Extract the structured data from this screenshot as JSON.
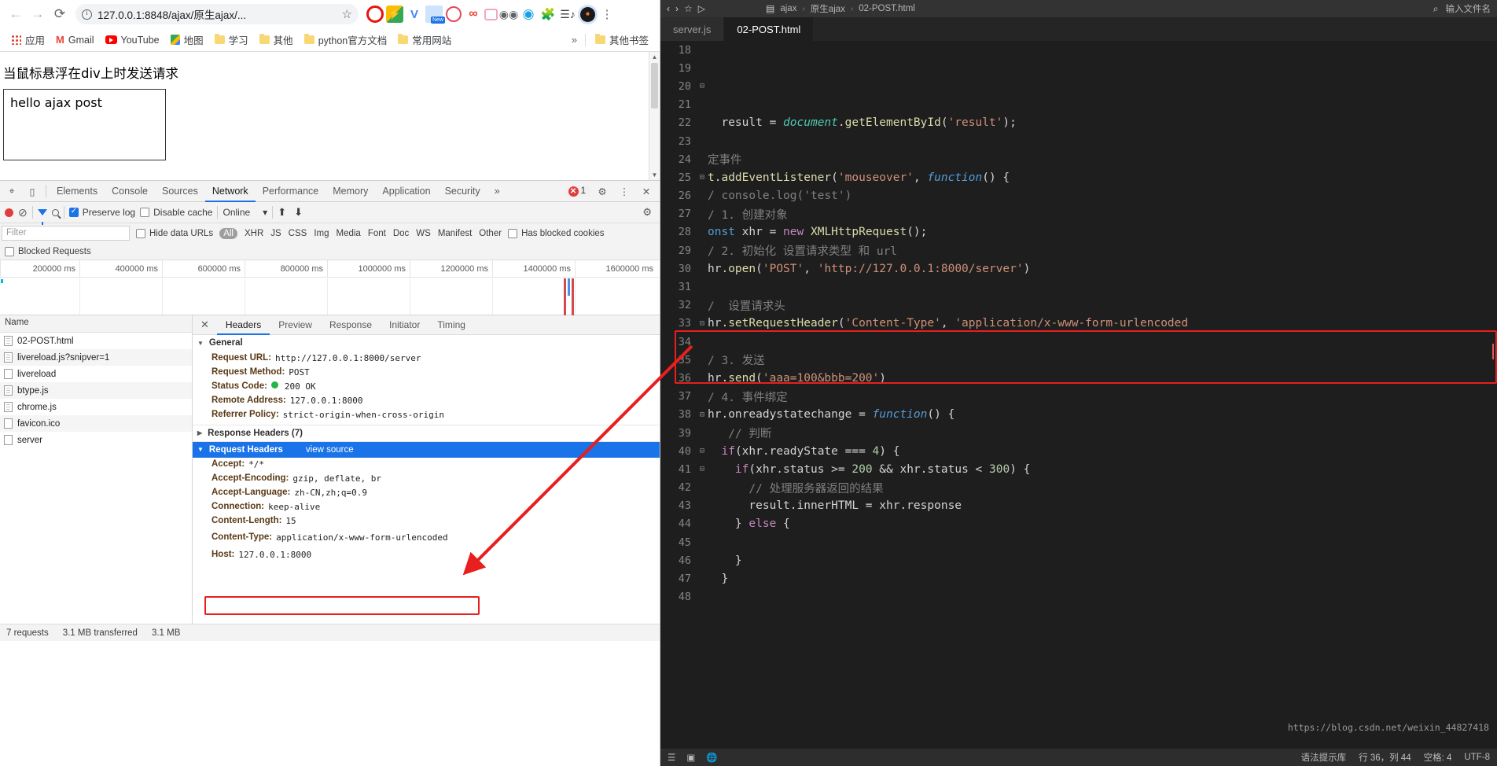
{
  "browser": {
    "nav": {
      "back": "←",
      "forward": "→",
      "reload": "⟳"
    },
    "address": {
      "url": "127.0.0.1:8848/ajax/原生ajax/...",
      "security_icon": "info-icon",
      "star_icon": "star-icon"
    },
    "extensions": [
      "opera-icon",
      "lightning-icon",
      "v-icon",
      "new-badge-icon",
      "play-icon",
      "infinity-icon",
      "tv-icon",
      "goggles-icon",
      "blue-circle-icon",
      "puzzle-icon",
      "playlist-icon",
      "profile-avatar",
      "menu-dots-icon"
    ],
    "bookmarks": [
      {
        "label": "应用",
        "icon": "apps-grid-icon"
      },
      {
        "label": "Gmail",
        "icon": "gmail-icon"
      },
      {
        "label": "YouTube",
        "icon": "youtube-icon"
      },
      {
        "label": "地图",
        "icon": "maps-icon"
      },
      {
        "label": "学习",
        "icon": "folder-icon"
      },
      {
        "label": "其他",
        "icon": "folder-icon"
      },
      {
        "label": "python官方文档",
        "icon": "folder-icon"
      },
      {
        "label": "常用网站",
        "icon": "folder-icon"
      }
    ],
    "bookmarks_overflow": "»",
    "bookmarks_other": {
      "label": "其他书签",
      "icon": "folder-icon"
    }
  },
  "page": {
    "heading": "当鼠标悬浮在div上时发送请求",
    "result_box_text": "hello ajax post"
  },
  "devtools": {
    "tabs": [
      "Elements",
      "Console",
      "Sources",
      "Network",
      "Performance",
      "Memory",
      "Application",
      "Security"
    ],
    "active_tab": "Network",
    "overflow": "»",
    "error_count": "1",
    "toolbar": {
      "preserve_log": "Preserve log",
      "preserve_log_checked": true,
      "disable_cache": "Disable cache",
      "disable_cache_checked": false,
      "throttling": "Online",
      "dropdown_caret": "▾"
    },
    "filter": {
      "placeholder": "Filter",
      "hide_data_urls": "Hide data URLs",
      "types": [
        "All",
        "XHR",
        "JS",
        "CSS",
        "Img",
        "Media",
        "Font",
        "Doc",
        "WS",
        "Manifest",
        "Other"
      ],
      "active_type": "All",
      "has_blocked_cookies": "Has blocked cookies",
      "blocked_requests": "Blocked Requests"
    },
    "overview_ticks": [
      "200000 ms",
      "400000 ms",
      "600000 ms",
      "800000 ms",
      "1000000 ms",
      "1200000 ms",
      "1400000 ms",
      "1600000 ms"
    ],
    "requests": {
      "column_header": "Name",
      "rows": [
        {
          "name": "02-POST.html",
          "icon": "document-icon"
        },
        {
          "name": "livereload.js?snipver=1",
          "icon": "script-icon"
        },
        {
          "name": "livereload",
          "icon": "other-icon"
        },
        {
          "name": "btype.js",
          "icon": "script-icon"
        },
        {
          "name": "chrome.js",
          "icon": "script-icon"
        },
        {
          "name": "favicon.ico",
          "icon": "other-icon"
        },
        {
          "name": "server",
          "icon": "other-icon"
        }
      ]
    },
    "detail": {
      "tabs": [
        "Headers",
        "Preview",
        "Response",
        "Initiator",
        "Timing"
      ],
      "active_tab": "Headers",
      "close_icon": "✕",
      "general": {
        "title": "General",
        "rows": [
          {
            "key": "Request URL:",
            "value": "http://127.0.0.1:8000/server"
          },
          {
            "key": "Request Method:",
            "value": "POST"
          },
          {
            "key": "Status Code:",
            "value": "200 OK",
            "status_dot": "#29b24a"
          },
          {
            "key": "Remote Address:",
            "value": "127.0.0.1:8000"
          },
          {
            "key": "Referrer Policy:",
            "value": "strict-origin-when-cross-origin"
          }
        ]
      },
      "response_headers": {
        "title": "Response Headers (7)"
      },
      "request_headers": {
        "title": "Request Headers",
        "view_source": "view source",
        "rows": [
          {
            "key": "Accept:",
            "value": "*/*"
          },
          {
            "key": "Accept-Encoding:",
            "value": "gzip, deflate, br"
          },
          {
            "key": "Accept-Language:",
            "value": "zh-CN,zh;q=0.9"
          },
          {
            "key": "Connection:",
            "value": "keep-alive"
          },
          {
            "key": "Content-Length:",
            "value": "15"
          },
          {
            "key": "Content-Type:",
            "value": "application/x-www-form-urlencoded",
            "highlighted": true
          },
          {
            "key": "Host:",
            "value": "127.0.0.1:8000"
          }
        ]
      }
    },
    "status": {
      "requests": "7 requests",
      "transferred": "3.1 MB transferred",
      "resources": "3.1 MB"
    }
  },
  "editor": {
    "breadcrumb": [
      "ajax",
      "原生ajax",
      "02-POST.html"
    ],
    "breadcrumb_sep": "›",
    "top_placeholder": "输入文件名",
    "tabs": [
      {
        "label": "server.js",
        "active": false
      },
      {
        "label": "02-POST.html",
        "active": true
      }
    ],
    "first_line": 18,
    "lines": [
      {
        "n": 18,
        "fold": "",
        "text": ""
      },
      {
        "n": 19,
        "fold": "",
        "text": ""
      },
      {
        "n": 20,
        "fold": "⊟",
        "text": ""
      },
      {
        "n": 21,
        "fold": "",
        "text": ""
      },
      {
        "n": 22,
        "fold": "",
        "text": "  result = document.getElementById('result');"
      },
      {
        "n": 23,
        "fold": "",
        "text": ""
      },
      {
        "n": 24,
        "fold": "",
        "text": "定事件"
      },
      {
        "n": 25,
        "fold": "⊟",
        "text": "t.addEventListener('mouseover', function() {"
      },
      {
        "n": 26,
        "fold": "",
        "text": "/ console.log('test')"
      },
      {
        "n": 27,
        "fold": "",
        "text": "/ 1. 创建对象"
      },
      {
        "n": 28,
        "fold": "",
        "text": "onst xhr = new XMLHttpRequest();"
      },
      {
        "n": 29,
        "fold": "",
        "text": "/ 2. 初始化 设置请求类型 和 url"
      },
      {
        "n": 30,
        "fold": "",
        "text": "hr.open('POST', 'http://127.0.0.1:8000/server')"
      },
      {
        "n": 31,
        "fold": "",
        "text": ""
      },
      {
        "n": 32,
        "fold": "",
        "text": "/  设置请求头"
      },
      {
        "n": 33,
        "fold": "⊟",
        "text": "hr.setRequestHeader('Content-Type', 'application/x-www-form-urlencoded"
      },
      {
        "n": 34,
        "fold": "",
        "text": ""
      },
      {
        "n": 35,
        "fold": "",
        "text": "/ 3. 发送"
      },
      {
        "n": 36,
        "fold": "",
        "text": "hr.send('aaa=100&bbb=200')"
      },
      {
        "n": 37,
        "fold": "",
        "text": "/ 4. 事件绑定"
      },
      {
        "n": 38,
        "fold": "⊟",
        "text": "hr.onreadystatechange = function() {"
      },
      {
        "n": 39,
        "fold": "",
        "text": "   // 判断"
      },
      {
        "n": 40,
        "fold": "⊟",
        "text": "  if(xhr.readyState === 4) {"
      },
      {
        "n": 41,
        "fold": "⊟",
        "text": "    if(xhr.status >= 200 && xhr.status < 300) {"
      },
      {
        "n": 42,
        "fold": "",
        "text": "      // 处理服务器返回的结果"
      },
      {
        "n": 43,
        "fold": "",
        "text": "      result.innerHTML = xhr.response"
      },
      {
        "n": 44,
        "fold": "",
        "text": "    } else {"
      },
      {
        "n": 45,
        "fold": "",
        "text": ""
      },
      {
        "n": 46,
        "fold": "",
        "text": "    }"
      },
      {
        "n": 47,
        "fold": "",
        "text": "  }"
      },
      {
        "n": 48,
        "fold": "",
        "text": ""
      }
    ],
    "status": {
      "left_icons": [
        "list-icon",
        "panel-icon",
        "globe-icon"
      ],
      "position": "行 36，列 44",
      "spaces": "空格: 4",
      "encoding": "UTF-8",
      "hint": "语法提示库"
    },
    "watermark": "https://blog.csdn.net/weixin_44827418"
  },
  "colors": {
    "accent_blue": "#1a73e8",
    "highlight_red": "#e81f1f",
    "status_green": "#29b24a",
    "editor_bg": "#1e1e1e"
  }
}
